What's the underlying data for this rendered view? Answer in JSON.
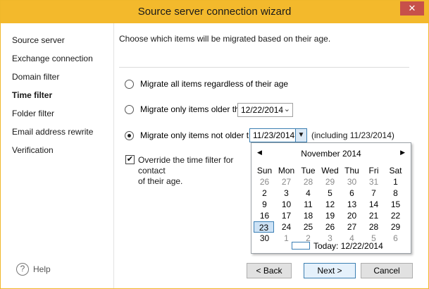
{
  "window": {
    "title": "Source server connection wizard",
    "close_glyph": "✕"
  },
  "sidebar": {
    "items": [
      {
        "label": "Source server"
      },
      {
        "label": "Exchange connection"
      },
      {
        "label": "Domain filter"
      },
      {
        "label": "Time filter",
        "active": true
      },
      {
        "label": "Folder filter"
      },
      {
        "label": "Email address rewrite"
      },
      {
        "label": "Verification"
      }
    ],
    "help_label": "Help",
    "help_glyph": "?"
  },
  "main": {
    "instructions": "Choose which items will be migrated based on their age.",
    "options": [
      {
        "label": "Migrate all items regardless of their age",
        "checked": false
      },
      {
        "label": "Migrate only items older than",
        "checked": false,
        "date": "12/22/2014"
      },
      {
        "label": "Migrate only items not older than",
        "checked": true,
        "date": "11/23/2014",
        "suffix": "(including 11/23/2014)"
      }
    ],
    "override_label": "Override the time filter for contact",
    "override_label_2": "of their age.",
    "override_checked": true,
    "check_glyph": "✔"
  },
  "calendar": {
    "month": "November 2014",
    "prev_glyph": "◀",
    "next_glyph": "▶",
    "days_of_week": [
      "Sun",
      "Mon",
      "Tue",
      "Wed",
      "Thu",
      "Fri",
      "Sat"
    ],
    "weeks": [
      [
        "26",
        "27",
        "28",
        "29",
        "30",
        "31",
        "1"
      ],
      [
        "2",
        "3",
        "4",
        "5",
        "6",
        "7",
        "8"
      ],
      [
        "9",
        "10",
        "11",
        "12",
        "13",
        "14",
        "15"
      ],
      [
        "16",
        "17",
        "18",
        "19",
        "20",
        "21",
        "22"
      ],
      [
        "23",
        "24",
        "25",
        "26",
        "27",
        "28",
        "29"
      ],
      [
        "30",
        "1",
        "2",
        "3",
        "4",
        "5",
        "6"
      ]
    ],
    "selected": "23",
    "today_label": "Today: 12/22/2014"
  },
  "buttons": {
    "back": "< Back",
    "next": "Next >",
    "cancel": "Cancel"
  }
}
